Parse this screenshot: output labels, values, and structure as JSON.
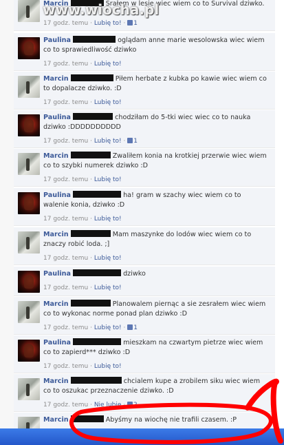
{
  "watermark": "www.wiocha.pl",
  "comments": [
    {
      "author": "Marcin",
      "text": "Srałem w lesie wiec wiem co to Survival dziwko.",
      "time": "17 godz. temu",
      "like": "Lubię to!",
      "likes": "1"
    },
    {
      "author": "Paulina",
      "text": "oglądam anne marie wesolowska wiec wiem co to sprawiedliwość dziwko",
      "time": "17 godz. temu",
      "like": "Lubię to!",
      "likes": ""
    },
    {
      "author": "Marcin",
      "text": "Piłem herbate z kubka po kawie wiec wiem co to dopalacze dziwko. :D",
      "time": "17 godz. temu",
      "like": "Lubię to!",
      "likes": ""
    },
    {
      "author": "Paulina",
      "text": "chodziłam do 5-tki wiec wiec co to nauka dziwko :DDDDDDDDDD",
      "time": "17 godz. temu",
      "like": "Lubię to!",
      "likes": "1"
    },
    {
      "author": "Marcin",
      "text": "Zwaliłem konia na krotkiej przerwie wiec wiem co to szybki numerek dziwko :D",
      "time": "17 godz. temu",
      "like": "Lubię to!",
      "likes": ""
    },
    {
      "author": "Paulina",
      "text": "ha! gram w szachy wiec wiem co to walenie konia, dziwko :D",
      "time": "17 godz. temu",
      "like": "Lubię to!",
      "likes": ""
    },
    {
      "author": "Marcin",
      "text": "Mam maszynke do lodów wiec wiem co to znaczy robić loda. ;]",
      "time": "17 godz. temu",
      "like": "Lubię to!",
      "likes": ""
    },
    {
      "author": "Paulina",
      "text": "dziwko",
      "time": "17 godz. temu",
      "like": "Lubię to!",
      "likes": ""
    },
    {
      "author": "Marcin",
      "text": "Planowalem piernąc a sie zesrałem wiec wiem co to wykonac norme ponad plan dziwko :D",
      "time": "17 godz. temu",
      "like": "Lubię to!",
      "likes": "1"
    },
    {
      "author": "Paulina",
      "text": "mieszkam na czwartym pietrze wiec wiem co to zapierd*** dziwko :D",
      "time": "17 godz. temu",
      "like": "Lubię to!",
      "likes": ""
    },
    {
      "author": "Marcin",
      "text": "chcialem kupe a zrobilem siku wiec wiem co to oszukac przeznaczenie dziwko. :D",
      "time": "17 godz. temu",
      "like": "Nie lubię",
      "likes": "2"
    },
    {
      "author": "Marcin",
      "text": "Abyśmy na wiochę nie trafili czasem. :P",
      "time": "",
      "like": "",
      "likes": ""
    }
  ],
  "colors": {
    "link": "#3b5998",
    "meta": "#8c8c8c",
    "highlight": "#ff0000",
    "taskbar": "#2d66d6"
  }
}
